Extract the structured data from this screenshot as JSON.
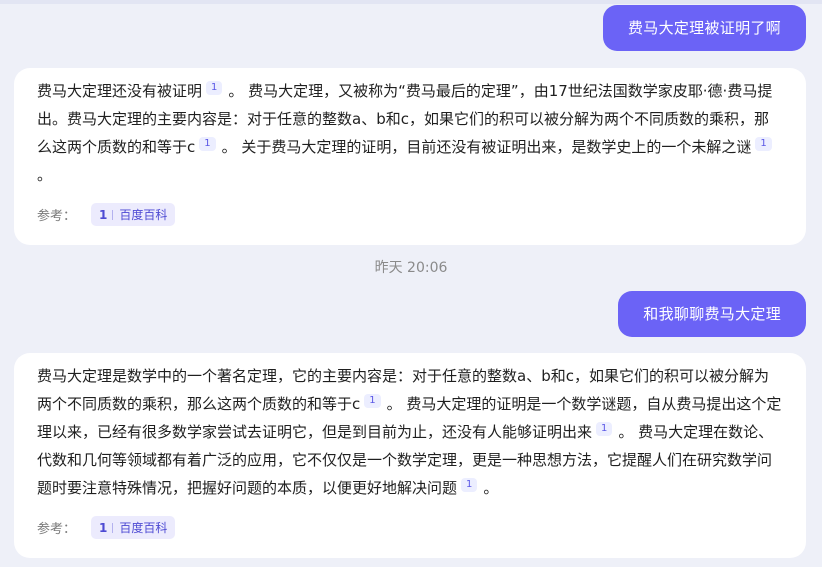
{
  "messages": [
    {
      "role": "user",
      "text": "费马大定理被证明了啊"
    },
    {
      "role": "assistant",
      "segments": [
        {
          "text": "费马大定理还没有被证明"
        },
        {
          "cite": "1"
        },
        {
          "text": "。 费马大定理，又被称为“费马最后的定理”，由17世纪法国数学家皮耶·德·费马提出。费马大定理的主要内容是：对于任意的整数a、b和c，如果它们的积可以被分解为两个不同质数的乘积，那么这两个质数的和等于c"
        },
        {
          "cite": "1"
        },
        {
          "text": "。 关于费马大定理的证明，目前还没有被证明出来，是数学史上的一个未解之谜"
        },
        {
          "cite": "1"
        },
        {
          "text": "。"
        }
      ],
      "refs_label": "参考：",
      "ref": {
        "num": "1",
        "source": "百度百科"
      }
    },
    {
      "role": "timestamp",
      "text": "昨天 20:06"
    },
    {
      "role": "user",
      "text": "和我聊聊费马大定理"
    },
    {
      "role": "assistant",
      "segments": [
        {
          "text": "费马大定理是数学中的一个著名定理，它的主要内容是：对于任意的整数a、b和c，如果它们的积可以被分解为两个不同质数的乘积，那么这两个质数的和等于c"
        },
        {
          "cite": "1"
        },
        {
          "text": "。 费马大定理的证明是一个数学谜题，自从费马提出这个定理以来，已经有很多数学家尝试去证明它，但是到目前为止，还没有人能够证明出来"
        },
        {
          "cite": "1"
        },
        {
          "text": "。 费马大定理在数论、代数和几何等领域都有着广泛的应用，它不仅仅是一个数学定理，更是一种思想方法，它提醒人们在研究数学问题时要注意特殊情况，把握好问题的本质，以便更好地解决问题"
        },
        {
          "cite": "1"
        },
        {
          "text": "。"
        }
      ],
      "refs_label": "参考：",
      "ref": {
        "num": "1",
        "source": "百度百科"
      }
    }
  ]
}
